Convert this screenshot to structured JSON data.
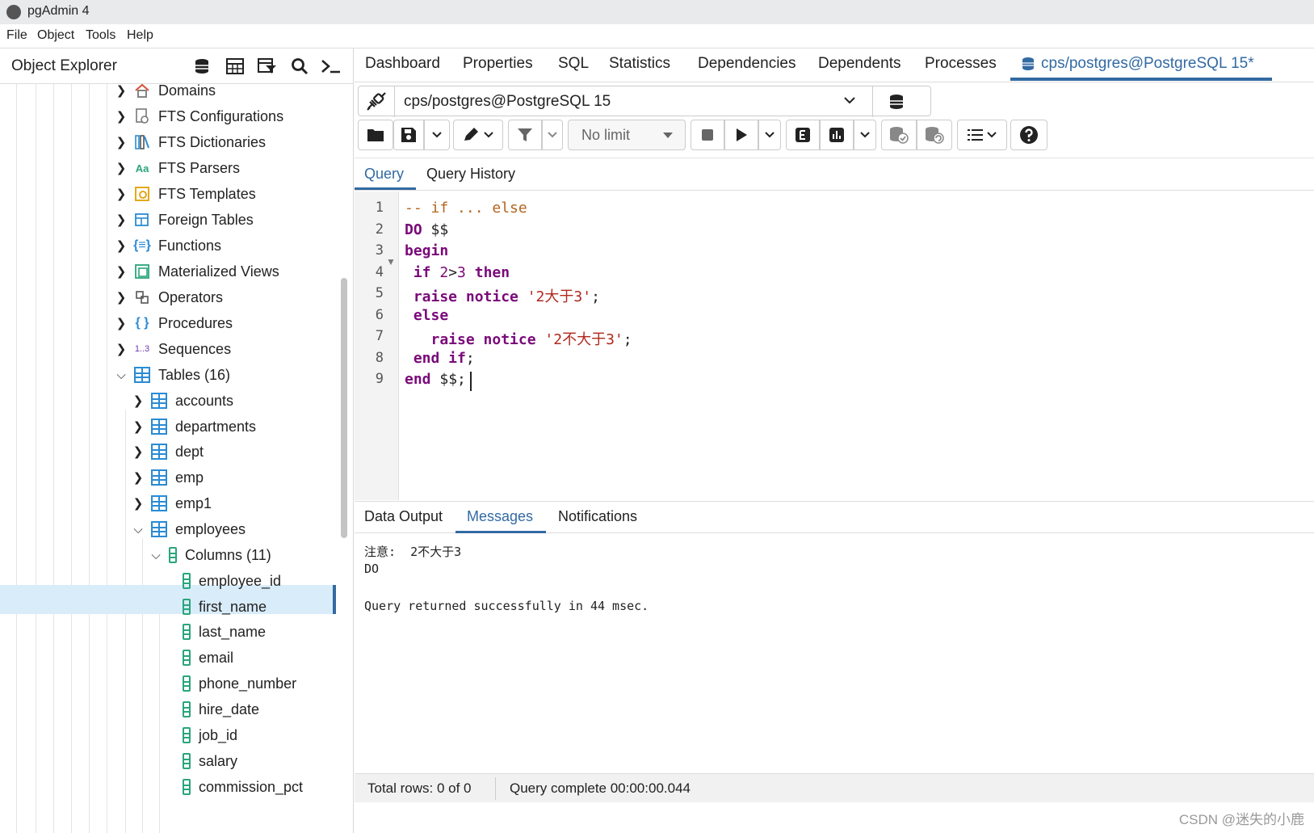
{
  "window": {
    "title": "pgAdmin 4"
  },
  "menu": [
    "File",
    "Object",
    "Tools",
    "Help"
  ],
  "explorer": {
    "title": "Object Explorer",
    "items": [
      {
        "label": "Domains"
      },
      {
        "label": "FTS Configurations"
      },
      {
        "label": "FTS Dictionaries"
      },
      {
        "label": "FTS Parsers",
        "icon_text": "Aa"
      },
      {
        "label": "FTS Templates"
      },
      {
        "label": "Foreign Tables"
      },
      {
        "label": "Functions"
      },
      {
        "label": "Materialized Views"
      },
      {
        "label": "Operators"
      },
      {
        "label": "Procedures"
      },
      {
        "label": "Sequences",
        "icon_text": "1..3"
      },
      {
        "label": "Tables (16)"
      },
      {
        "label": "accounts"
      },
      {
        "label": "departments"
      },
      {
        "label": "dept"
      },
      {
        "label": "emp"
      },
      {
        "label": "emp1"
      },
      {
        "label": "employees"
      },
      {
        "label": "Columns (11)"
      },
      {
        "label": "employee_id"
      },
      {
        "label": "first_name"
      },
      {
        "label": "last_name"
      },
      {
        "label": "email"
      },
      {
        "label": "phone_number"
      },
      {
        "label": "hire_date"
      },
      {
        "label": "job_id"
      },
      {
        "label": "salary"
      },
      {
        "label": "commission_pct"
      }
    ]
  },
  "tabs": [
    "Dashboard",
    "Properties",
    "SQL",
    "Statistics",
    "Dependencies",
    "Dependents",
    "Processes",
    "cps/postgres@PostgreSQL 15*"
  ],
  "connection": "cps/postgres@PostgreSQL 15",
  "toolbar": {
    "limit": "No limit"
  },
  "query_tabs": [
    "Query",
    "Query History"
  ],
  "editor": {
    "line_numbers": [
      "1",
      "2",
      "3",
      "4",
      "5",
      "6",
      "7",
      "8",
      "9"
    ],
    "lines": [
      [
        {
          "t": "-- if ... else",
          "c": "cm"
        }
      ],
      [
        {
          "t": "DO",
          "c": "kw"
        },
        {
          "t": " $$",
          "c": ""
        }
      ],
      [
        {
          "t": "begin",
          "c": "kw"
        }
      ],
      [
        {
          "t": " if ",
          "c": "kw"
        },
        {
          "t": "2",
          "c": "nm"
        },
        {
          "t": ">",
          "c": ""
        },
        {
          "t": "3",
          "c": "nm"
        },
        {
          "t": " then",
          "c": "kw"
        }
      ],
      [
        {
          "t": " raise notice ",
          "c": "kw"
        },
        {
          "t": "'2大于3'",
          "c": "st"
        },
        {
          "t": ";",
          "c": ""
        }
      ],
      [
        {
          "t": " else",
          "c": "kw"
        }
      ],
      [
        {
          "t": "   raise notice ",
          "c": "kw"
        },
        {
          "t": "'2不大于3'",
          "c": "st"
        },
        {
          "t": ";",
          "c": ""
        }
      ],
      [
        {
          "t": " end if",
          "c": "kw"
        },
        {
          "t": ";",
          "c": ""
        }
      ],
      [
        {
          "t": "end",
          "c": "kw"
        },
        {
          "t": " $$;",
          "c": ""
        }
      ]
    ]
  },
  "output_tabs": [
    "Data Output",
    "Messages",
    "Notifications"
  ],
  "messages": [
    "注意:  2不大于3",
    "DO",
    "",
    "Query returned successfully in 44 msec."
  ],
  "status": {
    "rows": "Total rows: 0 of 0",
    "query": "Query complete 00:00:00.044"
  },
  "watermark": "CSDN @迷失的小鹿",
  "colors": {
    "accent": "#326aa2",
    "selected_row": "#d9ecfa",
    "keyword": "#7a0a7a",
    "comment": "#b5651d",
    "string": "#b0281c"
  }
}
